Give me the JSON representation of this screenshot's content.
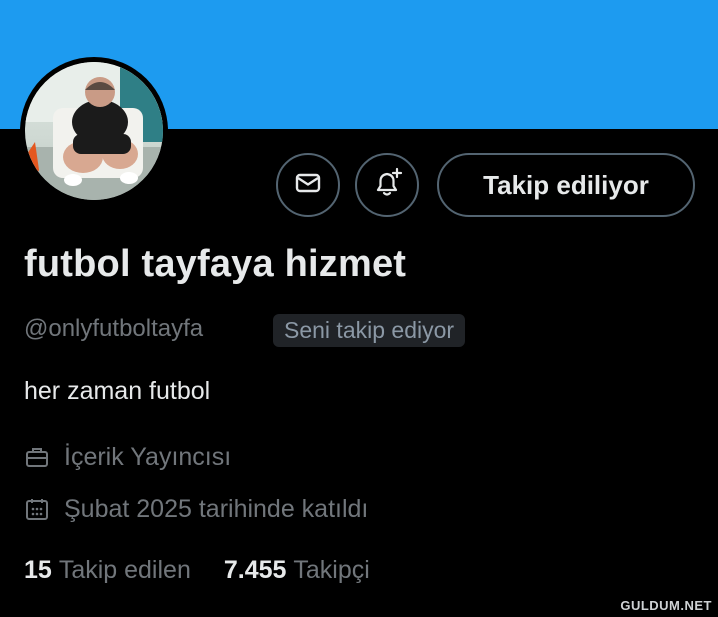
{
  "profile": {
    "display_name": "futbol tayfaya hizmet",
    "handle": "@onlyfutboltayfa",
    "follows_you_badge": "Seni takip ediyor",
    "bio": "her zaman futbol",
    "category": "İçerik Yayıncısı",
    "joined": "Şubat 2025 tarihinde katıldı"
  },
  "actions": {
    "message_icon": "envelope-icon",
    "notify_icon": "bell-plus-icon",
    "follow_label": "Takip ediliyor"
  },
  "stats": {
    "following_count": "15",
    "following_label": "Takip edilen",
    "followers_count": "7.455",
    "followers_label": "Takipçi"
  },
  "watermark": "GULDUM.NET",
  "colors": {
    "banner": "#1d9bf0",
    "background": "#000000",
    "primary_text": "#e7e9ea",
    "secondary_text": "#71767b",
    "border": "#536471"
  }
}
